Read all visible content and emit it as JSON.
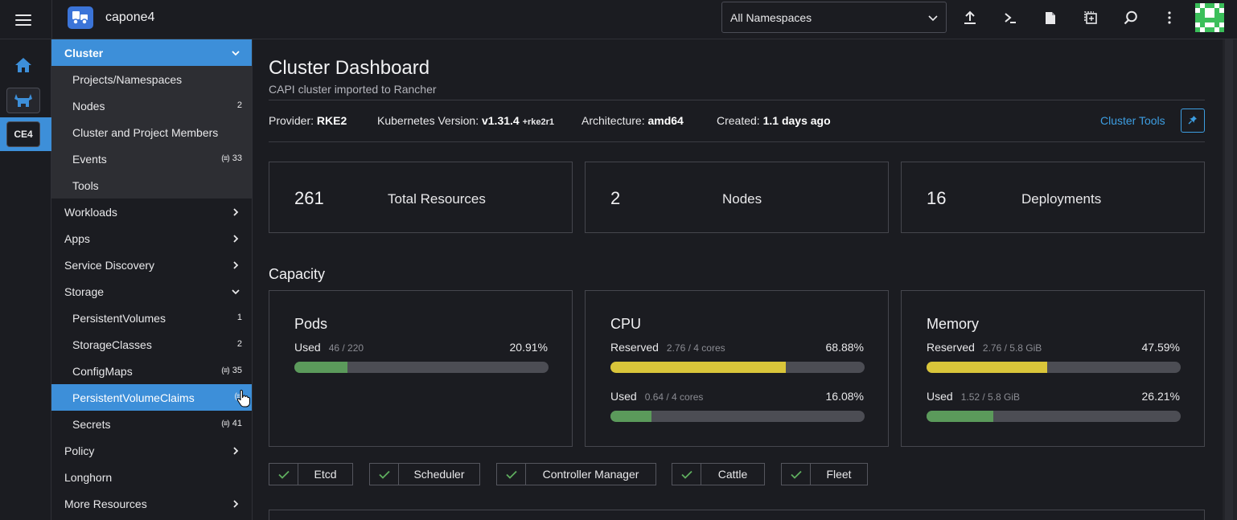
{
  "header": {
    "cluster_name": "capone4",
    "namespace_select": "All Namespaces",
    "icons": [
      "upload-icon",
      "kubectl-shell-icon",
      "kubeconfig-file-icon",
      "copy-kubeconfig-icon",
      "search-icon",
      "more-vertical-icon"
    ]
  },
  "rail": {
    "cluster_badge": "CE4"
  },
  "nav": {
    "cluster": "Cluster",
    "cluster_items": [
      {
        "label": "Projects/Namespaces",
        "count": ""
      },
      {
        "label": "Nodes",
        "count": "2"
      },
      {
        "label": "Cluster and Project Members",
        "count": ""
      },
      {
        "label": "Events",
        "count": "33"
      },
      {
        "label": "Tools",
        "count": ""
      }
    ],
    "workloads": "Workloads",
    "apps": "Apps",
    "service_discovery": "Service Discovery",
    "storage": "Storage",
    "storage_items": [
      {
        "label": "PersistentVolumes",
        "count": "1"
      },
      {
        "label": "StorageClasses",
        "count": "2"
      },
      {
        "label": "ConfigMaps",
        "count": "35"
      },
      {
        "label": "PersistentVolumeClaims",
        "count": ""
      },
      {
        "label": "Secrets",
        "count": "41"
      }
    ],
    "policy": "Policy",
    "longhorn": "Longhorn",
    "more_resources": "More Resources"
  },
  "main": {
    "title": "Cluster Dashboard",
    "subtitle": "CAPI cluster imported to Rancher",
    "provider_label": "Provider:",
    "provider_value": "RKE2",
    "k8s_label": "Kubernetes Version:",
    "k8s_value": "v1.31.4",
    "k8s_suffix": "+rke2r1",
    "arch_label": "Architecture:",
    "arch_value": "amd64",
    "created_label": "Created:",
    "created_value": "1.1 days ago",
    "cluster_tools": "Cluster Tools",
    "stats": [
      {
        "value": "261",
        "label": "Total Resources"
      },
      {
        "value": "2",
        "label": "Nodes"
      },
      {
        "value": "16",
        "label": "Deployments"
      }
    ],
    "capacity_title": "Capacity",
    "pods": {
      "name": "Pods",
      "used_label": "Used",
      "used_detail": "46 / 220",
      "used_pct": "20.91%",
      "used_frac": 0.2091
    },
    "cpu": {
      "name": "CPU",
      "reserved_label": "Reserved",
      "reserved_detail": "2.76 / 4 cores",
      "reserved_pct": "68.88%",
      "reserved_frac": 0.6888,
      "used_label": "Used",
      "used_detail": "0.64 / 4 cores",
      "used_pct": "16.08%",
      "used_frac": 0.1608
    },
    "memory": {
      "name": "Memory",
      "reserved_label": "Reserved",
      "reserved_detail": "2.76 / 5.8 GiB",
      "reserved_pct": "47.59%",
      "reserved_frac": 0.4759,
      "used_label": "Used",
      "used_detail": "1.52 / 5.8 GiB",
      "used_pct": "26.21%",
      "used_frac": 0.2621
    },
    "components": [
      "Etcd",
      "Scheduler",
      "Controller Manager",
      "Cattle",
      "Fleet"
    ]
  },
  "colors": {
    "accent": "#3d8fd9",
    "used_bar": "#5b9a5b",
    "reserved_bar": "#d9c53a",
    "check": "#5fae5f"
  }
}
